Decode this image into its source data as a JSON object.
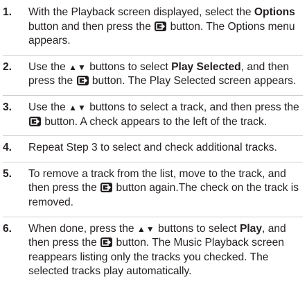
{
  "steps": [
    {
      "number": "1.",
      "parts": {
        "a": "With the Playback screen displayed, select the",
        "b": "Options",
        "c": "button and then press the",
        "icon": "enter-button-icon",
        "d": "button. The Options menu appears."
      }
    },
    {
      "number": "2.",
      "parts": {
        "a": "Use the",
        "arrows": "▲▼",
        "b": "buttons to select",
        "c": "Play Selected",
        "d": ", and then press the",
        "icon": "enter-button-icon",
        "e": "button. The Play Selected screen appears."
      }
    },
    {
      "number": "3.",
      "parts": {
        "a": "Use the",
        "arrows": "▲▼",
        "b": "buttons to select a track, and then press the",
        "icon": "enter-button-icon",
        "c": "button. A check appears to the left of the track."
      }
    },
    {
      "number": "4.",
      "parts": {
        "a": "Repeat Step 3 to select and check additional tracks."
      }
    },
    {
      "number": "5.",
      "parts": {
        "a": "To remove a track from the list, move to the track, and then press the",
        "icon": "enter-button-icon",
        "b": "button again.The check on the track is removed."
      }
    },
    {
      "number": "6.",
      "parts": {
        "a": "When done, press the",
        "arrows": "▲▼",
        "b": "buttons to select",
        "c": "Play",
        "d": ", and then press the",
        "icon": "enter-button-icon",
        "e": "button. The Music Playback screen reappears listing only the tracks you checked. The selected tracks play automatically."
      }
    }
  ]
}
